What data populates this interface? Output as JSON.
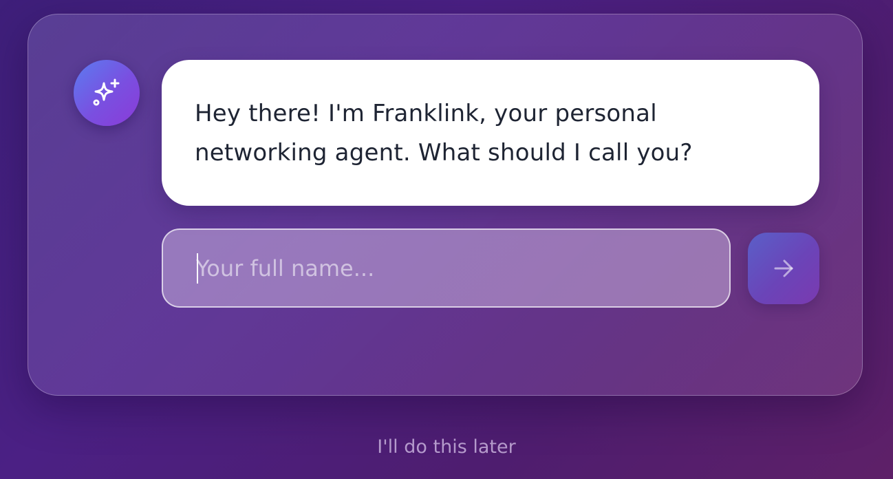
{
  "assistant": {
    "icon": "sparkles-icon",
    "message": "Hey there! I'm Franklink, your personal networking agent. What should I call you?"
  },
  "name_input": {
    "value": "",
    "placeholder": "Your full name..."
  },
  "send_button": {
    "icon": "arrow-right-icon"
  },
  "skip_link": {
    "label": "I'll do this later"
  },
  "colors": {
    "bubble_background": "#ffffff",
    "text_dark": "#1e2433",
    "avatar_gradient_start": "#5b7cf0",
    "avatar_gradient_end": "#8a3bd8",
    "send_gradient_start": "#5a5fc8",
    "send_gradient_end": "#7a3ab0"
  }
}
